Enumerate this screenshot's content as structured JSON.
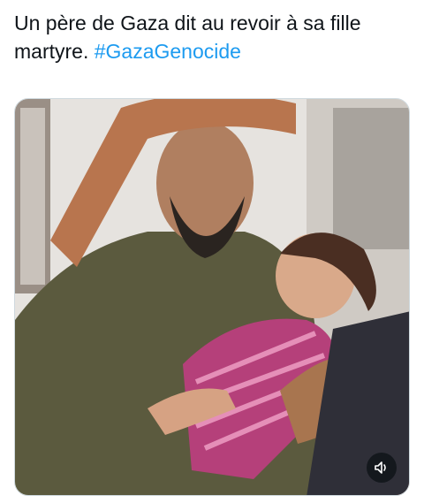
{
  "post": {
    "text": "Un père de Gaza dit au revoir à sa fille martyre.",
    "hashtag": "#GazaGenocide"
  },
  "media": {
    "type": "video",
    "sound_icon": "volume-icon"
  },
  "colors": {
    "text": "#0f1419",
    "hashtag": "#1d9bf0",
    "sound_button": "#0f1419"
  }
}
